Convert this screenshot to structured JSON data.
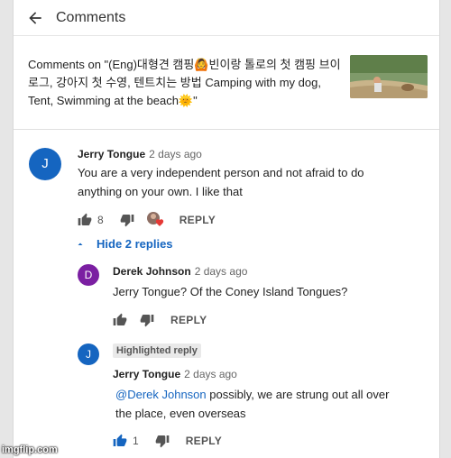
{
  "header": {
    "title": "Comments"
  },
  "video": {
    "title": "Comments on \"(Eng)대형견 캠핑🙆빈이랑 톨로의 첫 캠핑 브이로그, 강아지 첫 수영, 텐트치는 방법 Camping with my dog, Tent, Swimming at the beach🌞\""
  },
  "comments": [
    {
      "avatar_letter": "J",
      "avatar_color": "#1565c0",
      "author": "Jerry Tongue",
      "time": "2 days ago",
      "text": "You are a very independent person and not afraid to do anything on your own. I like that",
      "likes": "8",
      "reply_label": "REPLY"
    }
  ],
  "replies_toggle": {
    "label": "Hide 2 replies"
  },
  "replies": [
    {
      "avatar_letter": "D",
      "avatar_color": "#7b1fa2",
      "author": "Derek Johnson",
      "time": "2 days ago",
      "text": "Jerry Tongue? Of the Coney Island Tongues?",
      "reply_label": "REPLY"
    },
    {
      "avatar_letter": "J",
      "avatar_color": "#1565c0",
      "badge": "Highlighted reply",
      "author": "Jerry Tongue",
      "time": "2 days ago",
      "mention": "@Derek Johnson",
      "text": "possibly, we are strung out all over the place, even overseas",
      "likes": "1",
      "reply_label": "REPLY"
    }
  ],
  "watermark": "imgflip.com",
  "colors": {
    "accent": "#1565c0",
    "heart": "#e53935"
  }
}
